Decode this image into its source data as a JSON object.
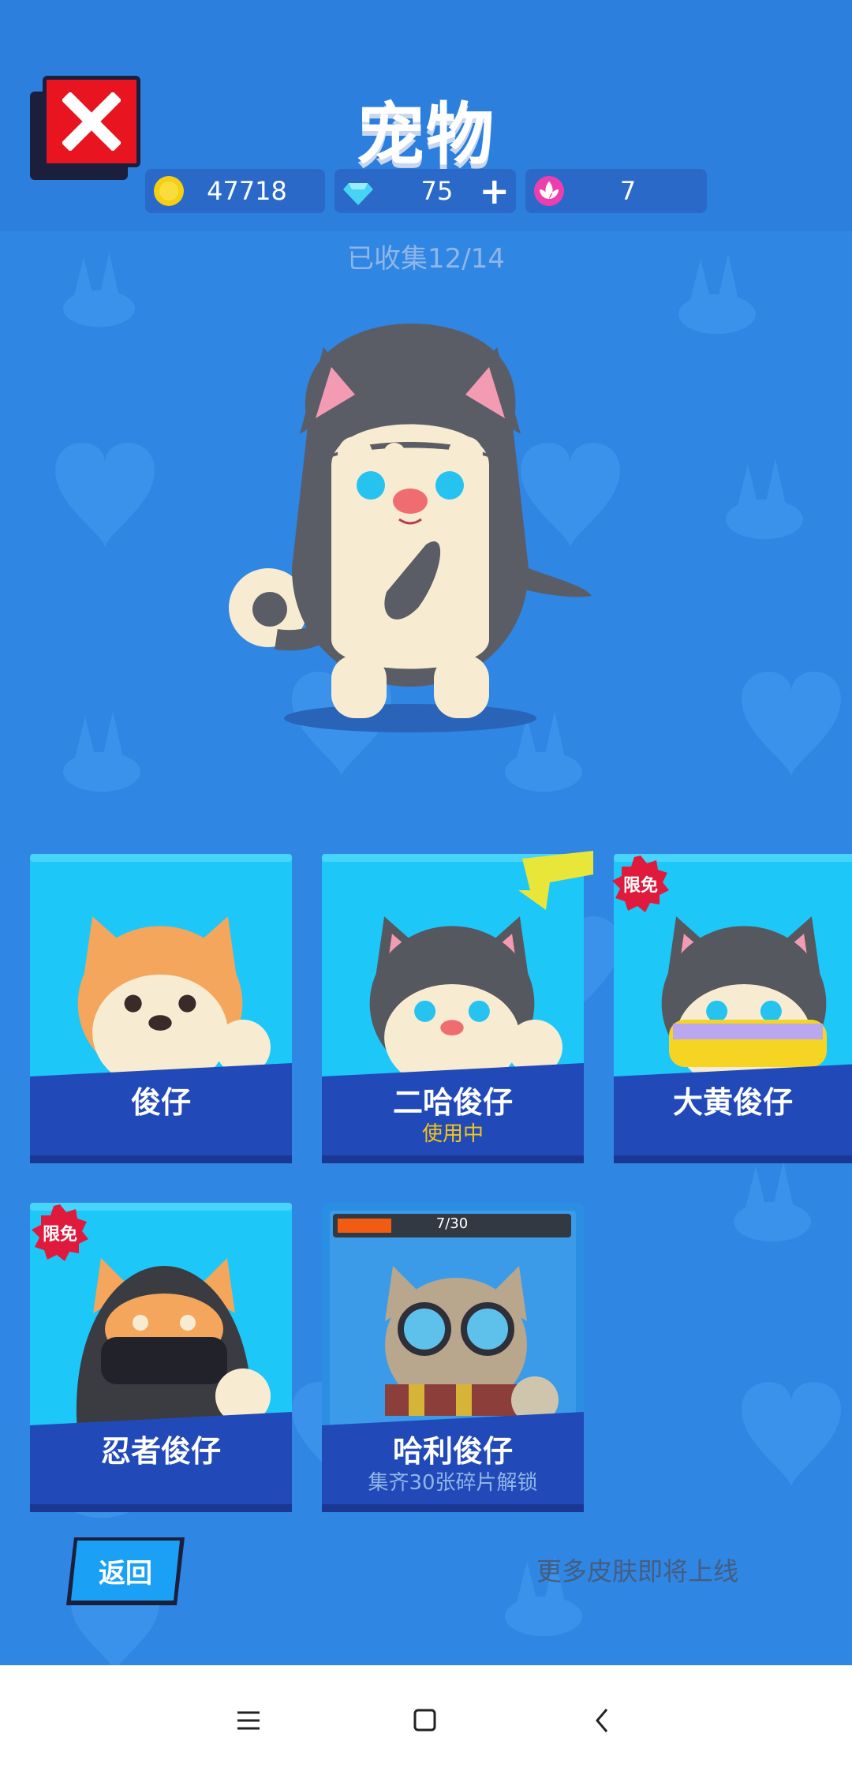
{
  "header": {
    "title": "宠物",
    "close_icon": "close-icon",
    "coins": {
      "icon": "coin-icon",
      "value": "47718"
    },
    "diamonds": {
      "icon": "diamond-icon",
      "value": "75",
      "plus_icon": "plus-icon"
    },
    "tokens": {
      "icon": "lotus-token-icon",
      "value": "7"
    }
  },
  "collected": "已收集12/14",
  "pets": [
    {
      "name": "俊仔",
      "status": "",
      "badge": ""
    },
    {
      "name": "二哈俊仔",
      "status": "使用中",
      "badge": ""
    },
    {
      "name": "大黄俊仔",
      "status": "",
      "badge": "限免"
    },
    {
      "name": "忍者俊仔",
      "status": "",
      "badge": "限免"
    },
    {
      "name": "哈利俊仔",
      "status": "集齐30张碎片解锁",
      "badge": "",
      "progress_text": "7/30",
      "progress_fraction": 0.233
    }
  ],
  "footer": {
    "back_label": "返回",
    "more_text": "更多皮肤即将上线"
  },
  "colors": {
    "background": "#2f86e3",
    "card_top": "#1dc7f7",
    "card_bottom": "#2249b8",
    "in_use": "#f3c51b",
    "badge": "#e01a3c"
  },
  "navbar": {
    "menu_icon": "menu-icon",
    "home_icon": "home-icon",
    "back_icon": "back-icon"
  }
}
